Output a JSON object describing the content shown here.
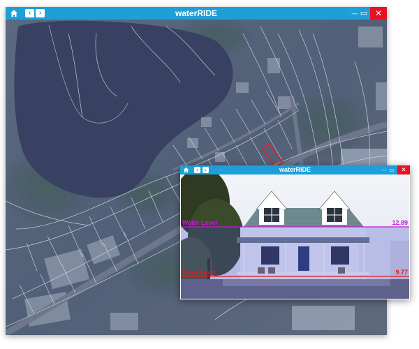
{
  "main_window": {
    "title": "waterRIDE",
    "back_glyph": "‹",
    "forward_glyph": "›",
    "minimize_glyph": "—",
    "maximize_glyph": "▭",
    "close_glyph": "✕"
  },
  "map": {
    "background_color": "#4a5870",
    "water_color": "#2f3758",
    "parcel_line_color": "#e6ecf5",
    "highlight_parcel_color": "#e01b1b"
  },
  "popup_window": {
    "title": "waterRIDE",
    "back_glyph": "‹",
    "forward_glyph": "›",
    "minimize_glyph": "—",
    "maximize_glyph": "▭",
    "close_glyph": "✕"
  },
  "levels": {
    "water_level": {
      "label": "Water Level",
      "value": "12.89",
      "color": "#c01bd6"
    },
    "floor_level": {
      "label": "Floor Level",
      "value": "9.77",
      "color": "#e01b1b"
    }
  },
  "icons": {
    "home": "home-icon",
    "back": "chevron-left-icon",
    "forward": "chevron-right-icon",
    "minimize": "minimize-icon",
    "maximize": "maximize-icon",
    "close": "close-icon"
  }
}
